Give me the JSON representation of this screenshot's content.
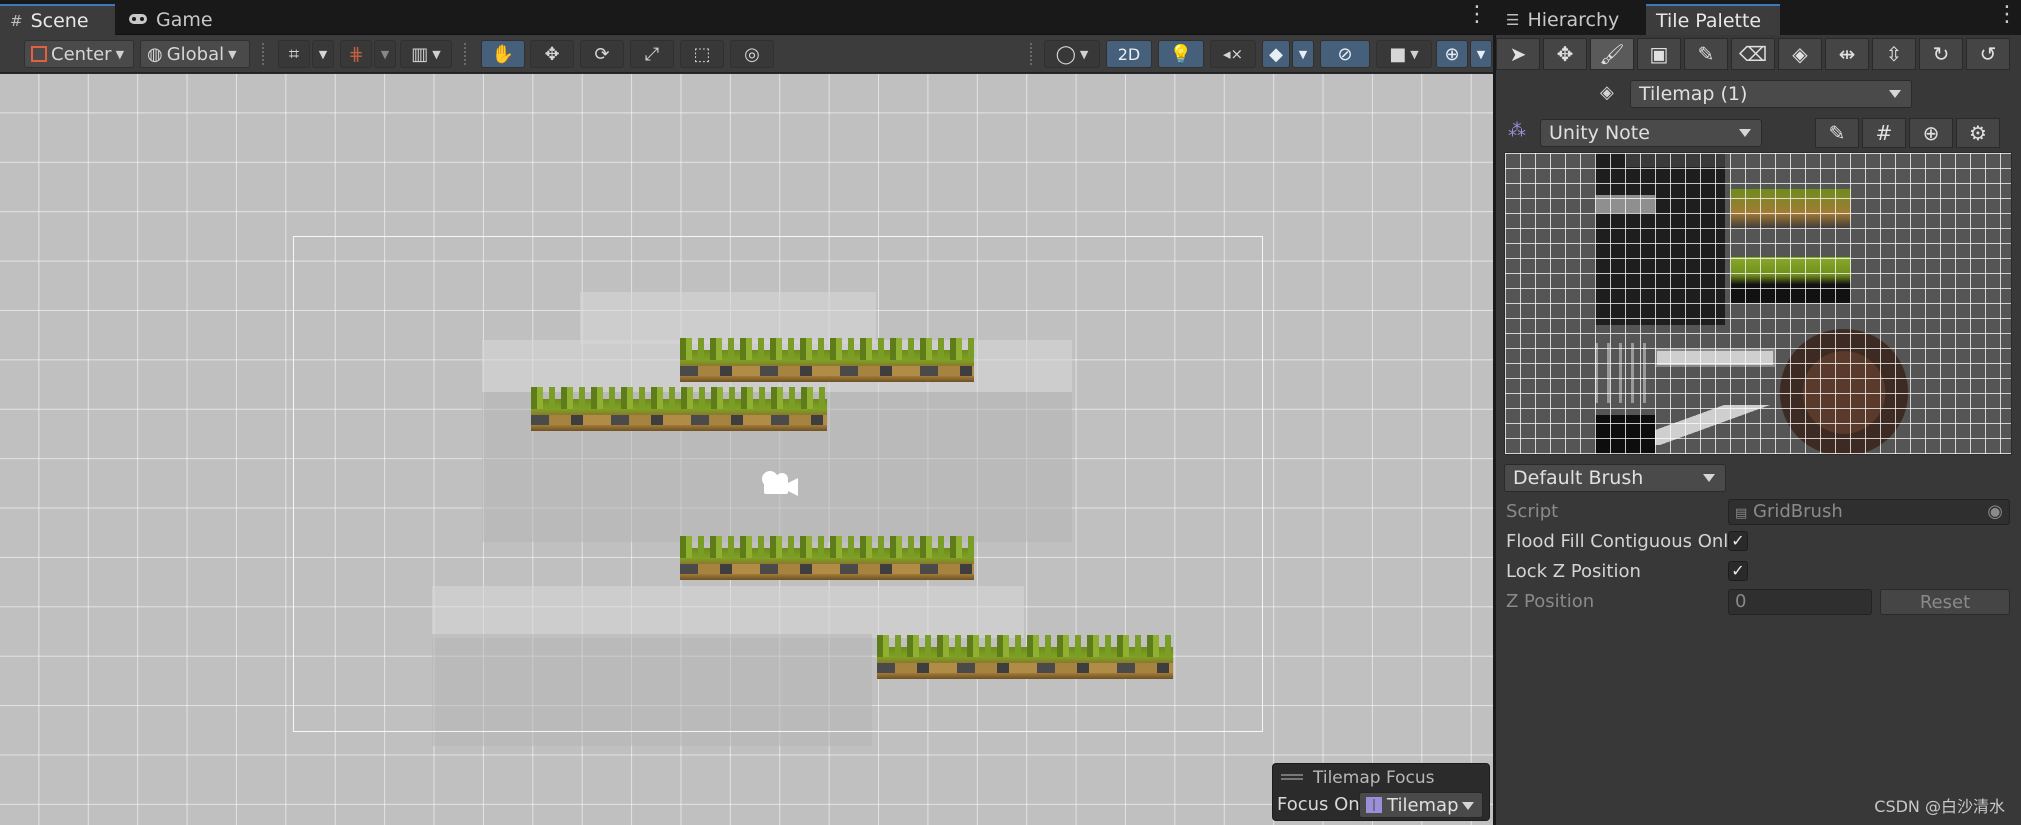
{
  "scene_tabs": [
    {
      "label": "Scene",
      "icon": "hash-icon"
    },
    {
      "label": "Game",
      "icon": "gamepad-icon"
    }
  ],
  "scene_toolbar": {
    "pivot_label": "Center",
    "space_label": "Global",
    "mode_2d_label": "2D"
  },
  "tilemap_focus": {
    "title": "Tilemap Focus",
    "focus_on_label": "Focus On",
    "focus_value": "Tilemap"
  },
  "right_tabs": [
    {
      "label": "Hierarchy",
      "icon": "list-icon"
    },
    {
      "label": "Tile Palette",
      "icon": ""
    }
  ],
  "tile_palette": {
    "active_tilemap": "Tilemap (1)",
    "palette_name": "Unity Note",
    "brush": "Default Brush",
    "properties": {
      "script_label": "Script",
      "script_value": "GridBrush",
      "flood_fill_label": "Flood Fill Contiguous Only",
      "flood_fill_checked": true,
      "lock_z_label": "Lock Z Position",
      "lock_z_checked": true,
      "z_position_label": "Z Position",
      "z_position_value": "0",
      "reset_label": "Reset"
    }
  },
  "watermark": "CSDN @白沙清水",
  "colors": {
    "accent_blue": "#46607c",
    "active_tab_border": "#3a79bb",
    "scene_background": "#c0c0c0",
    "grass_green": "#7fa123",
    "dirt_brown": "#a37b36"
  }
}
